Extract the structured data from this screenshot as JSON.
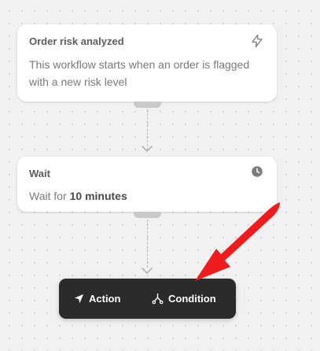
{
  "trigger_card": {
    "title": "Order risk analyzed",
    "description": "This workflow starts when an order is flagged with a new risk level",
    "icon": "lightning-bolt-icon"
  },
  "wait_card": {
    "title": "Wait",
    "description_prefix": "Wait for ",
    "duration": "10 minutes",
    "icon": "clock-icon"
  },
  "action_bar": {
    "action_label": "Action",
    "action_icon": "navigation-arrow-icon",
    "condition_label": "Condition",
    "condition_icon": "branch-icon"
  },
  "annotation": {
    "arrow_color": "#ee1c1c"
  }
}
